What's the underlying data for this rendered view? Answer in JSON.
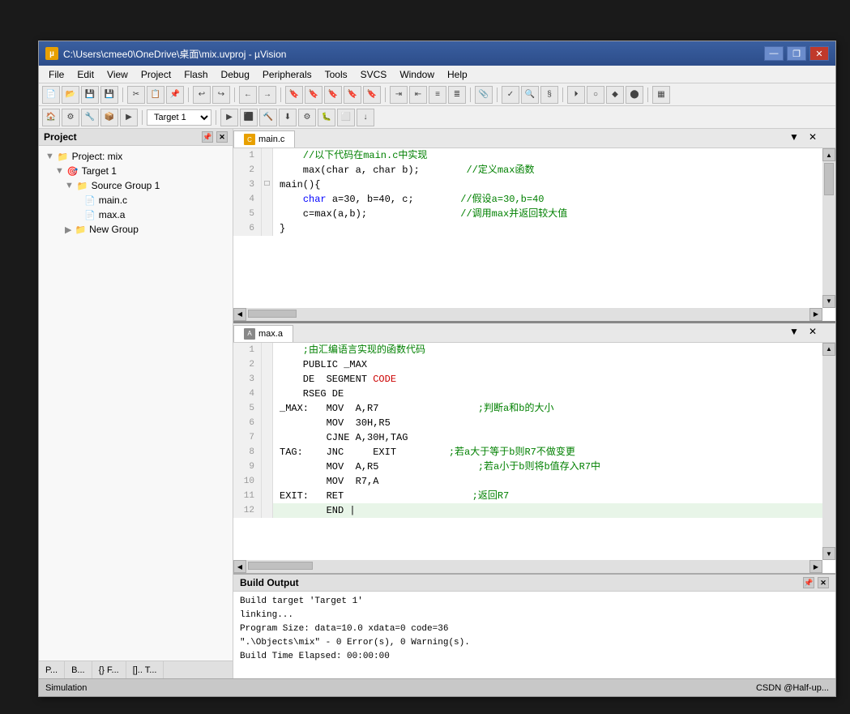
{
  "window": {
    "title": "C:\\Users\\cmee0\\OneDrive\\桌面\\mix.uvproj - µVision",
    "icon_label": "µ"
  },
  "title_buttons": {
    "minimize": "—",
    "restore": "❐",
    "close": "✕"
  },
  "menu": {
    "items": [
      "File",
      "Edit",
      "View",
      "Project",
      "Flash",
      "Debug",
      "Peripherals",
      "Tools",
      "SVCS",
      "Window",
      "Help"
    ]
  },
  "toolbar2": {
    "target": "Target 1"
  },
  "project_panel": {
    "title": "Project",
    "tree": [
      {
        "level": 0,
        "type": "project",
        "label": "Project: mix",
        "icon": "📁"
      },
      {
        "level": 1,
        "type": "target",
        "label": "Target 1",
        "icon": "🎯"
      },
      {
        "level": 2,
        "type": "folder",
        "label": "Source Group 1",
        "icon": "📁"
      },
      {
        "level": 3,
        "type": "file",
        "label": "main.c",
        "icon": "📄"
      },
      {
        "level": 3,
        "type": "file",
        "label": "max.a",
        "icon": "📄"
      },
      {
        "level": 2,
        "type": "folder",
        "label": "New Group",
        "icon": "📁"
      }
    ],
    "tabs": [
      "P...",
      "B...",
      "{} F...",
      "[].. T..."
    ]
  },
  "top_editor": {
    "tab_name": "main.c",
    "lines": [
      {
        "num": "1",
        "expand": "",
        "code": "    //以下代码在main.c中实现",
        "classes": [
          "c-comment"
        ]
      },
      {
        "num": "2",
        "expand": "",
        "code": "    max(char a, char b);        //定义max函数",
        "code_parts": [
          {
            "text": "    max(char a, char b);        ",
            "cls": "c-black"
          },
          {
            "text": "//定义max函数",
            "cls": "c-green"
          }
        ]
      },
      {
        "num": "3",
        "expand": "□",
        "code": "main(){",
        "code_parts": [
          {
            "text": "main()",
            "cls": "c-black"
          },
          {
            "text": "{",
            "cls": "c-black"
          }
        ]
      },
      {
        "num": "4",
        "expand": "",
        "code": "    char a=30, b=40, c;        //假设a=30,b=40",
        "code_parts": [
          {
            "text": "    ",
            "cls": ""
          },
          {
            "text": "char",
            "cls": "c-blue"
          },
          {
            "text": " a=30, b=40, c;        ",
            "cls": "c-black"
          },
          {
            "text": "//假设a=30,b=40",
            "cls": "c-green"
          }
        ]
      },
      {
        "num": "5",
        "expand": "",
        "code": "    c=max(a,b);                //调用max并返回较大值",
        "code_parts": [
          {
            "text": "    c=max(a,b);                ",
            "cls": "c-black"
          },
          {
            "text": "//调用max并返回较大值",
            "cls": "c-green"
          }
        ]
      },
      {
        "num": "6",
        "expand": "",
        "code": "}",
        "code_parts": [
          {
            "text": "}",
            "cls": "c-black"
          }
        ]
      }
    ]
  },
  "bottom_editor": {
    "tab_name": "max.a",
    "lines": [
      {
        "num": "1",
        "code_parts": [
          {
            "text": "    ;由汇编语言实现的函数代码",
            "cls": "c-green"
          }
        ]
      },
      {
        "num": "2",
        "code_parts": [
          {
            "text": "    PUBLIC _MAX",
            "cls": "c-black"
          }
        ]
      },
      {
        "num": "3",
        "code_parts": [
          {
            "text": "    DE  SEGMENT ",
            "cls": "c-black"
          },
          {
            "text": "CODE",
            "cls": "c-red"
          }
        ]
      },
      {
        "num": "4",
        "code_parts": [
          {
            "text": "    RSEG DE",
            "cls": "c-black"
          }
        ]
      },
      {
        "num": "5",
        "code_parts": [
          {
            "text": "_MAX:   MOV  A,R7",
            "cls": "c-black"
          },
          {
            "text": "                 ;判断a和b的大小",
            "cls": "c-green"
          }
        ]
      },
      {
        "num": "6",
        "code_parts": [
          {
            "text": "        MOV  30H,R5",
            "cls": "c-black"
          }
        ]
      },
      {
        "num": "7",
        "code_parts": [
          {
            "text": "        CJNE A,30H,TAG",
            "cls": "c-black"
          }
        ]
      },
      {
        "num": "8",
        "code_parts": [
          {
            "text": "TAG:    JNC     EXIT",
            "cls": "c-black"
          },
          {
            "text": "         ;若a大于等于b则R7不做变更",
            "cls": "c-green"
          }
        ]
      },
      {
        "num": "9",
        "code_parts": [
          {
            "text": "        MOV  A,R5",
            "cls": "c-black"
          },
          {
            "text": "                 ;若a小于b则将b值存入R7中",
            "cls": "c-green"
          }
        ]
      },
      {
        "num": "10",
        "code_parts": [
          {
            "text": "        MOV  R7,A",
            "cls": "c-black"
          }
        ]
      },
      {
        "num": "11",
        "code_parts": [
          {
            "text": "EXIT:   RET",
            "cls": "c-black"
          },
          {
            "text": "                      ;返回R7",
            "cls": "c-green"
          }
        ]
      },
      {
        "num": "12",
        "code_parts": [
          {
            "text": "        END ",
            "cls": "c-black"
          }
        ],
        "highlight": true
      }
    ]
  },
  "build_output": {
    "title": "Build Output",
    "lines": [
      "Build target 'Target 1'",
      "linking...",
      "Program Size: data=10.0 xdata=0 code=36",
      "\".\\Objects\\mix\" - 0 Error(s), 0 Warning(s).",
      "Build Time Elapsed:  00:00:00"
    ]
  },
  "status_bar": {
    "left": "Simulation",
    "right": "CSDN @Half-up..."
  }
}
